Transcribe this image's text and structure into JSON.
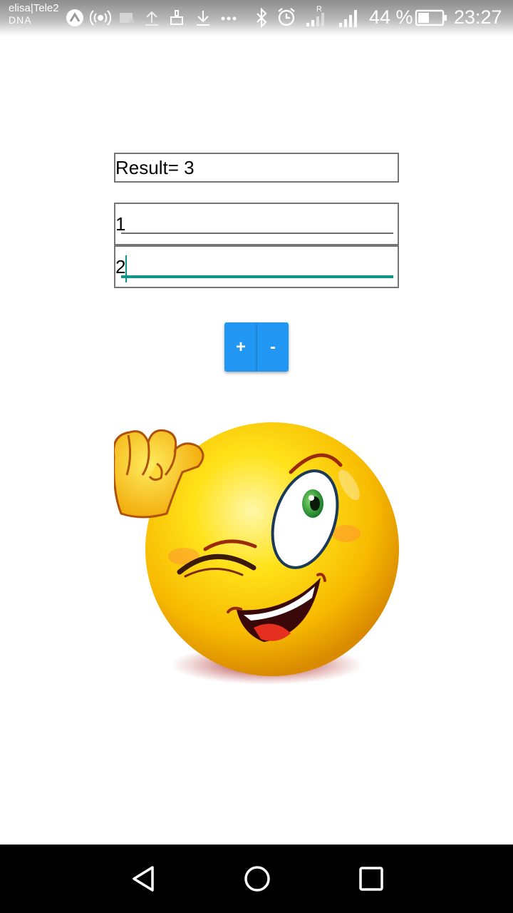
{
  "status_bar": {
    "carrier_line1": "elisa|Tele2",
    "carrier_line2": "DNA",
    "roaming_marker": "R",
    "battery_percent": "44 %",
    "time": "23:27",
    "icons": [
      "app-notification-icon",
      "hotspot-icon",
      "sd-card-icon",
      "upload-icon",
      "cleaner-icon",
      "download-icon",
      "more-dots-icon",
      "bluetooth-icon",
      "alarm-icon",
      "signal-roaming-icon",
      "signal-icon",
      "battery-icon"
    ]
  },
  "calculator": {
    "result_text": "Result= 3",
    "input1_value": "1",
    "input2_value": "2",
    "plus_label": "+",
    "minus_label": "-"
  },
  "image": {
    "name": "winking-smiley"
  },
  "nav_bar": {
    "back": "back-icon",
    "home": "home-icon",
    "recents": "recents-icon"
  },
  "colors": {
    "button": "#2196f3",
    "focus_accent": "#119488",
    "nav_bg": "#000000"
  }
}
